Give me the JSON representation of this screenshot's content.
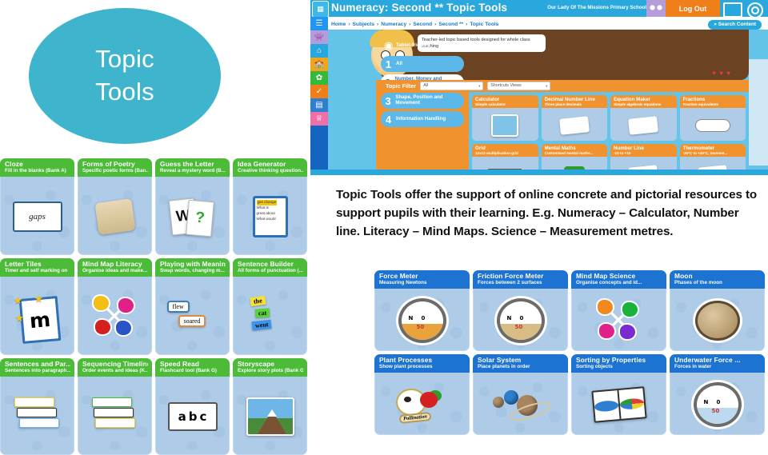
{
  "badge": {
    "line1": "Topic",
    "line2": "Tools",
    "color": "#3fb4cd"
  },
  "body_copy": "Topic Tools offer the support of online concrete and pictorial resources to support pupils with their learning. E.g. Numeracy – Calculator, Number line. Literacy – Mind Maps. Science – Measurement metres.",
  "webapp": {
    "title": "Numeracy: Second ** Topic Tools",
    "school": "Our Lady Of The Missions Primary School",
    "logout_label": "Log Out",
    "search_label": "Search Content",
    "breadcrumb": [
      "Home",
      "Subjects",
      "Numeracy",
      "Second",
      "Second **",
      "Topic Tools"
    ],
    "tooltip": "Teacher-led topic based tools designed for whole class teaching",
    "topic_filter_label": "Topic Filter",
    "filter_value_1": "All",
    "filter_value_2": "Shortcuts Views",
    "hearts": "♥ ♥ ♥",
    "side_items": [
      {
        "num": "",
        "label": "Tablet-friendly",
        "state": "plain"
      },
      {
        "num": "1",
        "label": "All",
        "state": "normal"
      },
      {
        "num": "2",
        "label": "Number, Money and Measurement",
        "state": "active"
      },
      {
        "num": "3",
        "label": "Shape, Position and Movement",
        "state": "normal"
      },
      {
        "num": "4",
        "label": "Information Handling",
        "state": "normal"
      }
    ],
    "rail_icons": [
      "hamburger-icon",
      "monster-avatar-icon",
      "home-icon",
      "school-icon",
      "plant-icon",
      "check-icon",
      "books-icon",
      "trophy-icon"
    ],
    "tools": [
      {
        "title": "Calculator",
        "sub": "Simple calculator",
        "art": "calculator"
      },
      {
        "title": "Decimal Number Line",
        "sub": "Three place decimals",
        "art": "numberline"
      },
      {
        "title": "Equation Maker",
        "sub": "Simple algebraic equations",
        "art": "equation"
      },
      {
        "title": "Fractions",
        "sub": "Fraction equivalents",
        "art": "fractions"
      },
      {
        "title": "Grid",
        "sub": "12x12 multiplication grid",
        "art": "grid"
      },
      {
        "title": "Mental Maths",
        "sub": "Customised mental maths...",
        "art": "mental"
      },
      {
        "title": "Number Line",
        "sub": "-10 to +10",
        "art": "numberline2"
      },
      {
        "title": "Thermometer",
        "sub": "-30°C to +40°C, increme...",
        "art": "thermometer"
      }
    ]
  },
  "literacy_tiles": [
    {
      "title": "Cloze",
      "sub": "Fill in the blanks (Bank A)",
      "art": "gaps"
    },
    {
      "title": "Forms of Poetry",
      "sub": "Specific poetic forms (Ban...",
      "art": "scroll"
    },
    {
      "title": "Guess the Letter",
      "sub": "Reveal a mystery word (B...",
      "art": "qcards"
    },
    {
      "title": "Idea Generator",
      "sub": "Creative thinking question...",
      "art": "ideacard"
    },
    {
      "title": "Letter Tiles",
      "sub": "Timer and self marking on",
      "art": "lettertile"
    },
    {
      "title": "Mind Map Literacy",
      "sub": "Organise ideas and make...",
      "art": "mindmap"
    },
    {
      "title": "Playing with Meaning",
      "sub": "Swap words, changing m...",
      "art": "wordbubbles"
    },
    {
      "title": "Sentence Builder",
      "sub": "All forms of punctuation (...",
      "art": "stickwords"
    },
    {
      "title": "Sentences and Par...",
      "sub": "Sentences into paragraph...",
      "art": "papers"
    },
    {
      "title": "Sequencing Timeline",
      "sub": "Order events and ideas (K...",
      "art": "timeline"
    },
    {
      "title": "Speed Read",
      "sub": "Flashcard tool (Bank G)",
      "art": "abc"
    },
    {
      "title": "Storyscape",
      "sub": "Explore story plots (Bank G)",
      "art": "mountain"
    }
  ],
  "literacy_art_text": {
    "gaps": "gaps",
    "qcard_letter": "W",
    "qcard_mark": "?",
    "idea_lines": [
      "gas change",
      "What is",
      "great about",
      "What would"
    ],
    "letter": "m",
    "word1": "flew",
    "word2": "soared",
    "stick1": "the",
    "stick2": "cat",
    "stick3": "went",
    "abc": [
      "a",
      "b",
      "c"
    ]
  },
  "science_tiles": [
    {
      "title": "Force Meter",
      "sub": "Measuring Newtons",
      "art": "meter"
    },
    {
      "title": "Friction Force Meter",
      "sub": "Forces between 2 surfaces",
      "art": "meter2"
    },
    {
      "title": "Mind Map Science",
      "sub": "Organise concepts and id...",
      "art": "mindmap"
    },
    {
      "title": "Moon",
      "sub": "Phases of the moon",
      "art": "moon"
    },
    {
      "title": "Plant Processes",
      "sub": "Show plant processes",
      "art": "pollination"
    },
    {
      "title": "Solar System",
      "sub": "Place planets in order",
      "art": "planets"
    },
    {
      "title": "Sorting by Properties",
      "sub": "Sorting objects",
      "art": "sorting"
    },
    {
      "title": "Underwater Force ...",
      "sub": "Forces in water",
      "art": "meter3"
    }
  ],
  "science_art_text": {
    "meter_n": "N",
    "meter_zero": "0",
    "meter_fifty": "50",
    "pollination": "Pollination"
  },
  "colors": {
    "literacy_header": "#4cbb38",
    "science_header": "#1c73d1",
    "numeracy_header": "#f0932e",
    "tile_body": "#aecbe8",
    "badge": "#3fb4cd"
  }
}
